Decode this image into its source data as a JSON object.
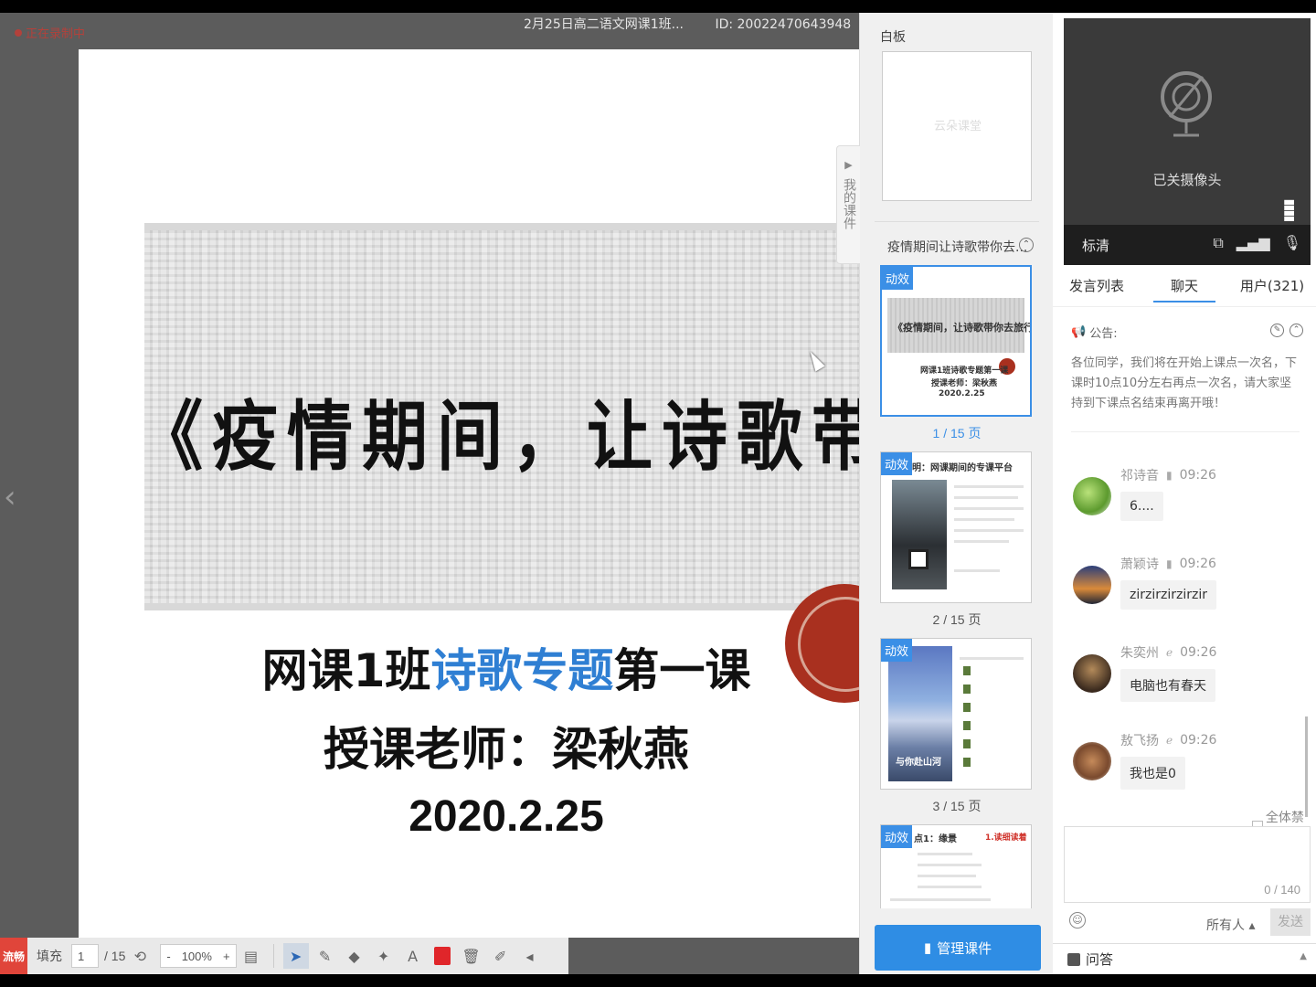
{
  "session": {
    "recording_label": "正在录制中",
    "title": "2月25日高二语文网课1班...",
    "id_text": "ID:  20022470643948"
  },
  "slide": {
    "title": "《疫情期间，让诗歌带你去旅行",
    "line1_pre": "网课1班",
    "line1_accent": "诗歌专题",
    "line1_post": "第一课",
    "line2": "授课老师：梁秋燕",
    "date": "2020.2.25"
  },
  "toolbar": {
    "fluency_label": "流畅",
    "fill_label": "填充",
    "page_value": "1",
    "page_total": "/ 15",
    "zoom_minus": "-",
    "zoom_value": "100%",
    "zoom_plus": "+",
    "text_tool": "A"
  },
  "courseware": {
    "my_docs_label": "我的课件",
    "whiteboard_label": "白板",
    "whiteboard_watermark": "云朵课堂",
    "doc_name": "疫情期间让诗歌带你去...",
    "anim_badge": "动效",
    "thumb1_title": "《疫情期间，让诗歌带你去旅行》",
    "thumb1_sub1": "网课1班诗歌专题第一课",
    "thumb1_sub2": "授课老师：梁秋燕",
    "thumb1_sub3": "2020.2.25",
    "thumb2_title": "明：网课期间的专课平台",
    "thumb3_caption": "与你赴山河",
    "thumb4_title": "点1：缘景",
    "thumb4_tag": "1.读细读着",
    "pages": [
      "1 / 15 页",
      "2 / 15 页",
      "3 / 15 页"
    ],
    "manage_label": "管理课件"
  },
  "camera": {
    "status": "已关摄像头",
    "quality": "标清"
  },
  "tabs": [
    "发言列表",
    "聊天",
    "用户(321)"
  ],
  "announcement": {
    "label": "公告:",
    "text": "各位同学，我们将在开始上课点一次名，下课时10点10分左右再点一次名，请大家坚持到下课点名结束再离开哦！"
  },
  "chat": {
    "messages": [
      {
        "name": "祁诗音",
        "time": "09:26",
        "text": "6...."
      },
      {
        "name": "萧颖诗",
        "time": "09:26",
        "text": "zirzirzirzirzir"
      },
      {
        "name": "朱奕州",
        "time": "09:26",
        "text": "电脑也有春天"
      },
      {
        "name": "敖飞扬",
        "time": "09:26",
        "text": "我也是0"
      }
    ],
    "mute_all_label": "全体禁言",
    "char_count": "0 / 140",
    "recipients": "所有人",
    "send_label": "发送",
    "qa_label": "问答"
  },
  "colors": {
    "accent": "#3b8fe6",
    "slide_accent": "#2f7fd3",
    "seal": "#a9301f",
    "fluency": "#e0453a"
  }
}
